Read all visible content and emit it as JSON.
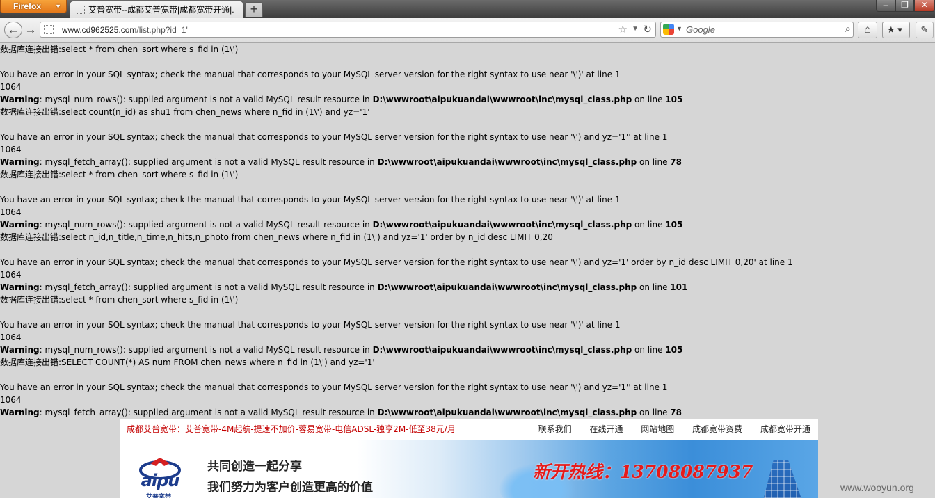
{
  "browser": {
    "menu_label": "Firefox",
    "tab_title": "艾普宽带--成都艾普宽带|成都宽带开通|...",
    "new_tab": "+",
    "url_host": "www.cd962525.com",
    "url_path": "/list.php?id=1'",
    "search_placeholder": "Google"
  },
  "error_blocks": [
    {
      "prefix": "数据库连接出错:",
      "query": "select * from chen_sort where s_fid in (1\\')",
      "syntax_error": "You have an error in your SQL syntax; check the manual that corresponds to your MySQL server version for the right syntax to use near '\\')' at line 1",
      "code": "1064",
      "warning_label": "Warning",
      "warning_msg": ": mysql_num_rows(): supplied argument is not a valid MySQL result resource in ",
      "path": "D:\\wwwroot\\aipukuandai\\wwwroot\\inc\\mysql_class.php",
      "on_line": " on line ",
      "line": "105"
    },
    {
      "prefix": "数据库连接出错:",
      "query": "select count(n_id) as shu1 from chen_news where n_fid in (1\\') and yz='1'",
      "syntax_error": "You have an error in your SQL syntax; check the manual that corresponds to your MySQL server version for the right syntax to use near '\\') and yz='1'' at line 1",
      "code": "1064",
      "warning_label": "Warning",
      "warning_msg": ": mysql_fetch_array(): supplied argument is not a valid MySQL result resource in ",
      "path": "D:\\wwwroot\\aipukuandai\\wwwroot\\inc\\mysql_class.php",
      "on_line": " on line ",
      "line": "78"
    },
    {
      "prefix": "数据库连接出错:",
      "query": "select * from chen_sort where s_fid in (1\\')",
      "syntax_error": "You have an error in your SQL syntax; check the manual that corresponds to your MySQL server version for the right syntax to use near '\\')' at line 1",
      "code": "1064",
      "warning_label": "Warning",
      "warning_msg": ": mysql_num_rows(): supplied argument is not a valid MySQL result resource in ",
      "path": "D:\\wwwroot\\aipukuandai\\wwwroot\\inc\\mysql_class.php",
      "on_line": " on line ",
      "line": "105"
    },
    {
      "prefix": "数据库连接出错:",
      "query": "select n_id,n_title,n_time,n_hits,n_photo from chen_news where n_fid in (1\\') and yz='1' order by n_id desc LIMIT 0,20",
      "syntax_error": "You have an error in your SQL syntax; check the manual that corresponds to your MySQL server version for the right syntax to use near '\\') and yz='1' order by n_id desc LIMIT 0,20' at line 1",
      "code": "1064",
      "warning_label": "Warning",
      "warning_msg": ": mysql_fetch_array(): supplied argument is not a valid MySQL result resource in ",
      "path": "D:\\wwwroot\\aipukuandai\\wwwroot\\inc\\mysql_class.php",
      "on_line": " on line ",
      "line": "101"
    },
    {
      "prefix": "数据库连接出错:",
      "query": "select * from chen_sort where s_fid in (1\\')",
      "syntax_error": "You have an error in your SQL syntax; check the manual that corresponds to your MySQL server version for the right syntax to use near '\\')' at line 1",
      "code": "1064",
      "warning_label": "Warning",
      "warning_msg": ": mysql_num_rows(): supplied argument is not a valid MySQL result resource in ",
      "path": "D:\\wwwroot\\aipukuandai\\wwwroot\\inc\\mysql_class.php",
      "on_line": " on line ",
      "line": "105"
    },
    {
      "prefix": "数据库连接出错:",
      "query": "SELECT COUNT(*) AS num FROM chen_news where n_fid in (1\\') and yz='1'",
      "syntax_error": "You have an error in your SQL syntax; check the manual that corresponds to your MySQL server version for the right syntax to use near '\\') and yz='1'' at line 1",
      "code": "1064",
      "warning_label": "Warning",
      "warning_msg": ": mysql_fetch_array(): supplied argument is not a valid MySQL result resource in ",
      "path": "D:\\wwwroot\\aipukuandai\\wwwroot\\inc\\mysql_class.php",
      "on_line": " on line ",
      "line": "78"
    }
  ],
  "site": {
    "promo": "成都艾普宽带：艾普宽带-4M起航-提速不加价-蓉易宽带-电信ADSL-独享2M-低至38元/月",
    "nav": [
      "联系我们",
      "在线开通",
      "网站地图",
      "成都宽带资费",
      "成都宽带开通"
    ],
    "logo_text": "aipu",
    "logo_cn": "艾普宽带",
    "slogan1": "共同创造一起分享",
    "slogan2": "我们努力为客户创造更高的价值",
    "hotline": "新开热线：13708087937"
  },
  "watermark": "www.wooyun.org",
  "colors": {
    "page_bg": "#d6d6d6",
    "promo_red": "#c40000",
    "hotline_red": "#e61a1a",
    "firefox_orange": "#e4781a"
  }
}
